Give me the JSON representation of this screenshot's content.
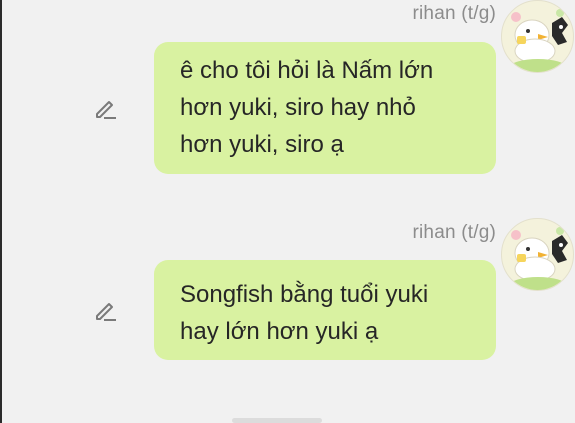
{
  "messages": [
    {
      "sender": "rihan (t/g)",
      "lines": [
        "ê cho tôi hỏi là Nấm lớn",
        "hơn yuki, siro hay nhỏ",
        "hơn yuki, siro ạ"
      ]
    },
    {
      "sender": "rihan (t/g)",
      "lines": [
        "Songfish bằng tuổi yuki",
        "hay lớn hơn yuki ạ"
      ]
    }
  ],
  "icons": {
    "edit": "pencil-edit-icon",
    "avatar": "duck-avatar"
  },
  "colors": {
    "bubble": "#d9f2a1",
    "background": "#f1f1f1",
    "sender": "#8c8c8c",
    "text": "#262626"
  }
}
